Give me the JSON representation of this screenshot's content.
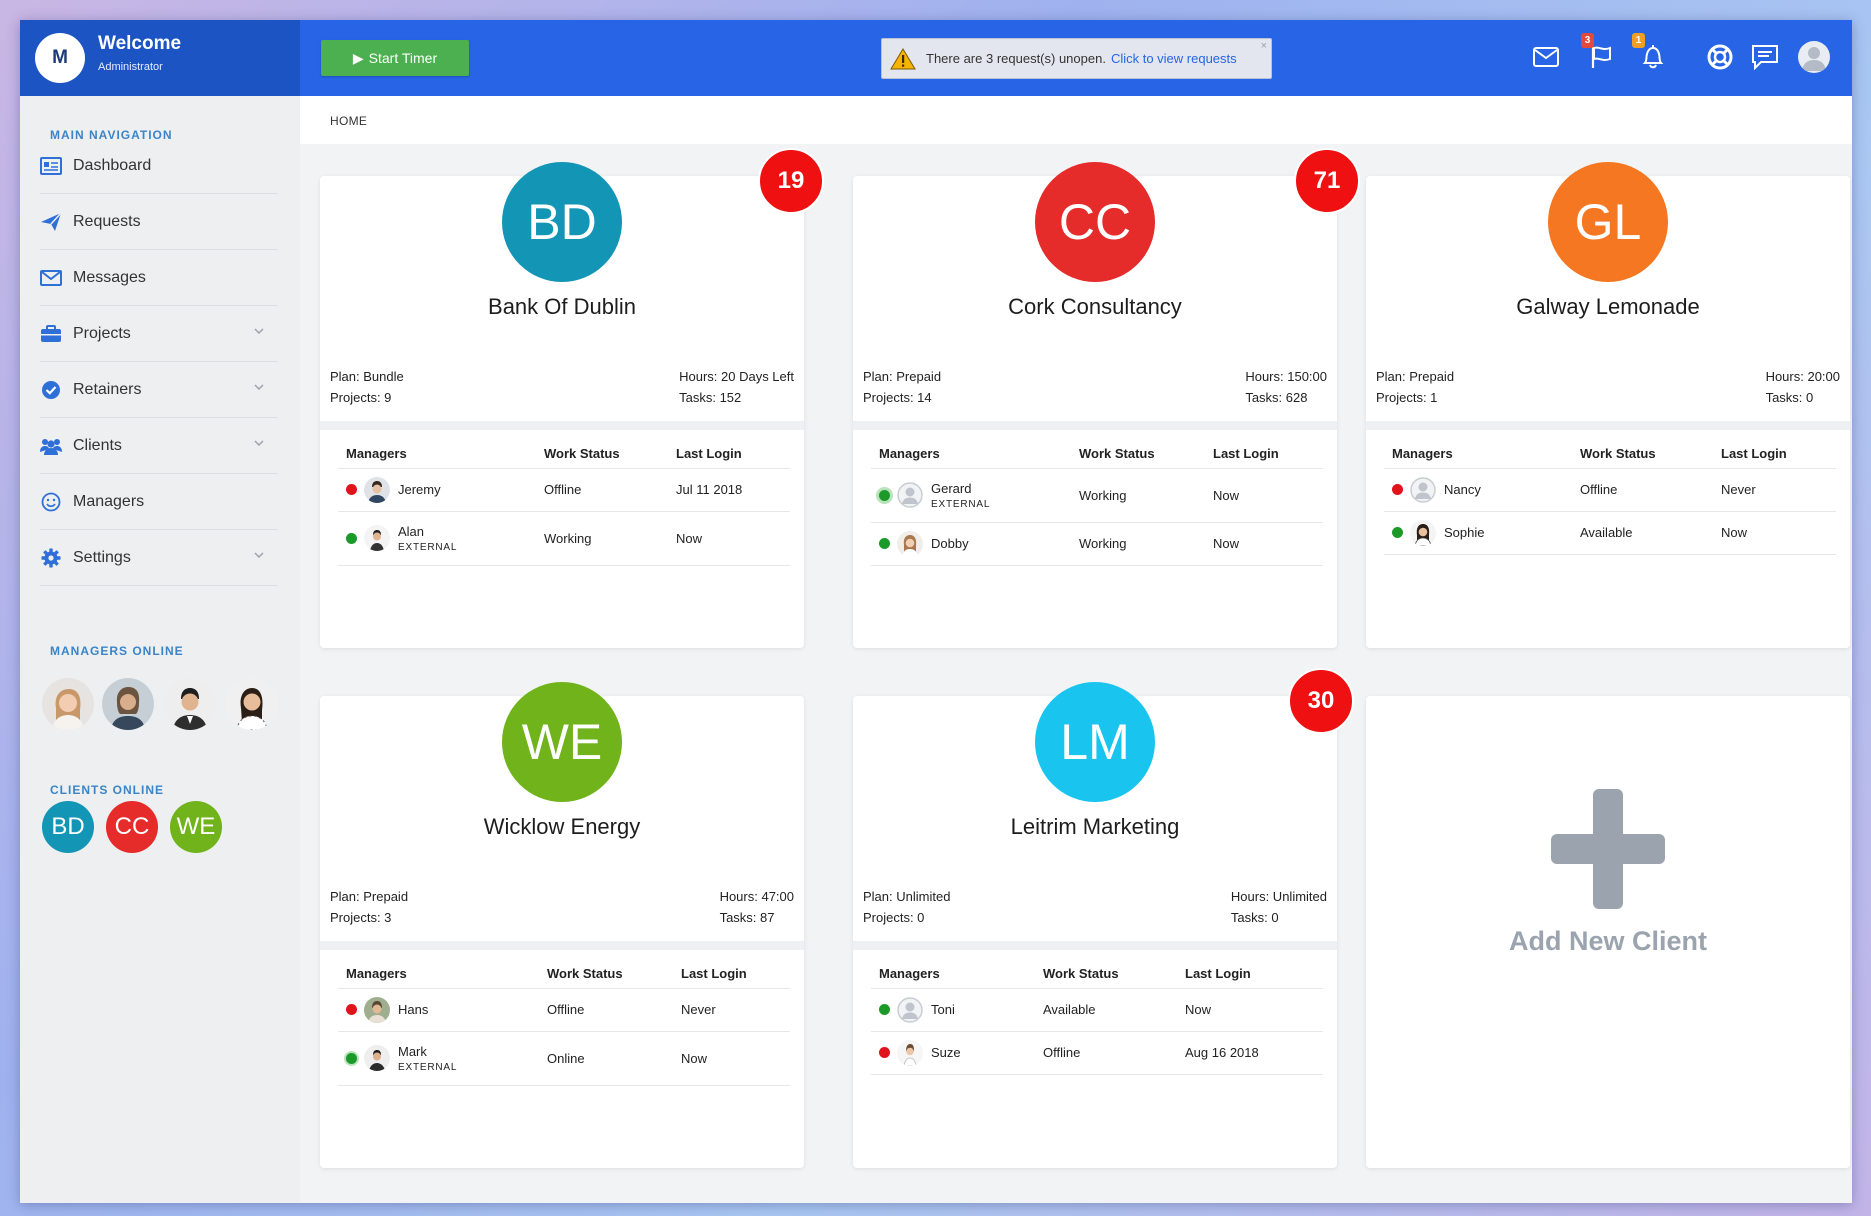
{
  "brand": {
    "logo_letter": "M",
    "welcome": "Welcome",
    "role": "Administrator"
  },
  "topbar": {
    "timer_label": "Start Timer",
    "alert_text": "There are 3 request(s) unopen.",
    "alert_link": "Click to view requests",
    "alert_close": "×",
    "messages_badge": "3",
    "flags_badge": "1"
  },
  "sidebar": {
    "main_nav_heading": "MAIN NAVIGATION",
    "items": [
      {
        "label": "Dashboard",
        "icon": "dashboard-icon"
      },
      {
        "label": "Requests",
        "icon": "paper-plane-icon"
      },
      {
        "label": "Messages",
        "icon": "envelope-icon"
      },
      {
        "label": "Projects",
        "icon": "briefcase-icon"
      },
      {
        "label": "Retainers",
        "icon": "check-circle-icon"
      },
      {
        "label": "Clients",
        "icon": "users-icon"
      },
      {
        "label": "Managers",
        "icon": "smile-icon"
      },
      {
        "label": "Settings",
        "icon": "gear-icon"
      }
    ],
    "managers_online_heading": "MANAGERS ONLINE",
    "clients_online_heading": "CLIENTS ONLINE",
    "clients_online": [
      "BD",
      "CC",
      "WE"
    ]
  },
  "breadcrumb": "HOME",
  "colors": {
    "primary": "#2764e6",
    "brand": "#1d54c4",
    "timer": "#4caf50",
    "badge": "#ef1111",
    "offline": "#e0121b",
    "online": "#1b9a2a"
  },
  "table_headers": {
    "managers": "Managers",
    "status": "Work Status",
    "login": "Last Login"
  },
  "cards": [
    {
      "initials": "BD",
      "name": "Bank Of Dublin",
      "color": "#1395b5",
      "badge": "19",
      "plan": "Plan: Bundle",
      "projects": "Projects: 9",
      "hours": "Hours: 20 Days Left",
      "tasks": "Tasks: 152",
      "managers": [
        {
          "name": "Jeremy",
          "external": "",
          "status": "Offline",
          "login": "Jul 11 2018",
          "status_color": "#e0121b"
        },
        {
          "name": "Alan",
          "external": "EXTERNAL",
          "status": "Working",
          "login": "Now",
          "status_color": "#1b9a2a"
        }
      ]
    },
    {
      "initials": "CC",
      "name": "Cork Consultancy",
      "color": "#e62b2b",
      "badge": "71",
      "plan": "Plan: Prepaid",
      "projects": "Projects: 14",
      "hours": "Hours: 150:00",
      "tasks": "Tasks: 628",
      "managers": [
        {
          "name": "Gerard",
          "external": "EXTERNAL",
          "status": "Working",
          "login": "Now",
          "status_color": "#1b9a2a"
        },
        {
          "name": "Dobby",
          "external": "",
          "status": "Working",
          "login": "Now",
          "status_color": "#1b9a2a"
        }
      ]
    },
    {
      "initials": "GL",
      "name": "Galway Lemonade",
      "color": "#f57722",
      "badge": "",
      "plan": "Plan: Prepaid",
      "projects": "Projects: 1",
      "hours": "Hours: 20:00",
      "tasks": "Tasks: 0",
      "managers": [
        {
          "name": "Nancy",
          "external": "",
          "status": "Offline",
          "login": "Never",
          "status_color": "#e0121b"
        },
        {
          "name": "Sophie",
          "external": "",
          "status": "Available",
          "login": "Now",
          "status_color": "#1b9a2a"
        }
      ]
    },
    {
      "initials": "WE",
      "name": "Wicklow Energy",
      "color": "#70b31a",
      "badge": "",
      "plan": "Plan: Prepaid",
      "projects": "Projects: 3",
      "hours": "Hours: 47:00",
      "tasks": "Tasks: 87",
      "managers": [
        {
          "name": "Hans",
          "external": "",
          "status": "Offline",
          "login": "Never",
          "status_color": "#e0121b"
        },
        {
          "name": "Mark",
          "external": "EXTERNAL",
          "status": "Online",
          "login": "Now",
          "status_color": "#1b9a2a"
        }
      ]
    },
    {
      "initials": "LM",
      "name": "Leitrim Marketing",
      "color": "#19c5ef",
      "badge": "30",
      "plan": "Plan: Unlimited",
      "projects": "Projects: 0",
      "hours": "Hours: Unlimited",
      "tasks": "Tasks: 0",
      "managers": [
        {
          "name": "Toni",
          "external": "",
          "status": "Available",
          "login": "Now",
          "status_color": "#1b9a2a"
        },
        {
          "name": "Suze",
          "external": "",
          "status": "Offline",
          "login": "Aug 16 2018",
          "status_color": "#e0121b"
        }
      ]
    }
  ],
  "add_client_label": "Add New Client"
}
